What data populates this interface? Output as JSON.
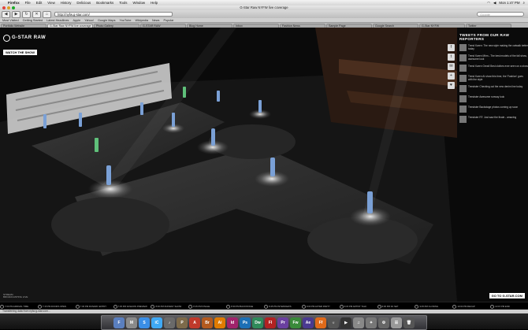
{
  "menubar": {
    "app": "Firefox",
    "items": [
      "File",
      "Edit",
      "View",
      "History",
      "Delicious",
      "Bookmarks",
      "Tools",
      "Window",
      "Help"
    ],
    "clock": "Mon 1:47 PM"
  },
  "window": {
    "title": "G-Star Raw NYFW live coverage"
  },
  "toolbar": {
    "url": "http://nyfw.g-star.com/",
    "search_placeholder": "Google"
  },
  "bookmarks": [
    "Most Visited",
    "Getting Started",
    "Latest Headlines",
    "Apple",
    "Yahoo!",
    "Google Maps",
    "YouTube",
    "Wikipedia",
    "News",
    "Popular"
  ],
  "tabs": [
    {
      "label": "Portfolio Website"
    },
    {
      "label": "Photo Gallery"
    },
    {
      "label": "G-STAR RAW"
    },
    {
      "label": "Blog Home"
    },
    {
      "label": "Inbox"
    },
    {
      "label": "Fashion News"
    },
    {
      "label": "Sample Page"
    },
    {
      "label": "Google Search"
    },
    {
      "label": "G-Star NYFW"
    },
    {
      "label": "Twitter"
    },
    {
      "label": "Flickr"
    }
  ],
  "active_tab": "G-Star Raw NYFW live coverage",
  "stage": {
    "logo": "G-STAR RAW",
    "watch_button": "WATCH THE SHOW",
    "credit_line1": "STREAM",
    "credit_line2": "BROADCASTING LIVE",
    "go_button": "GO TO G-STAR.COM"
  },
  "twitter": {
    "heading": "TWEETS FROM OUR RAW REPORTERS",
    "tweets": [
      "Trend Karen: The new style making the catwalk better today",
      "Trend Karen Mhm...The best models of the fall show, awesome look",
      "Trend Karen Great! Best clothes ever seen on a show",
      "Trend Karen At show this time, the 'Fashion' goes with the style",
      "Trendster Checking out the new denim line today",
      "Trendster Awesome runway look",
      "Trendster Backstage photos coming up soon",
      "Trendster RT: Just saw the finale - amazing"
    ],
    "share_icons": [
      "f",
      "t",
      "✉",
      "+",
      "♥"
    ]
  },
  "schedule": [
    "7:00 PM ARRIVAL TIME",
    "7:15 PM DOORS OPEN",
    "7:30 PM RUNWAY ENTRY",
    "7:45 PM FASHION PREVIEW",
    "8:00 PM RUNWAY SHOW",
    "8:15 PM FINALE",
    "8:30 PM BACKSTAGE",
    "8:45 PM INTERVIEWS",
    "9:00 PM AFTER PARTY",
    "9:15 PM ARTIST TALK",
    "9:30 PM DJ SET",
    "9:45 PM CLOSING",
    "10:00 PM RECAP",
    "10:15 PM END"
  ],
  "status": {
    "text": "Transferring data from nyfw.g-star.com..."
  },
  "dock": [
    {
      "label": "F",
      "color": "#5a7fbf"
    },
    {
      "label": "M",
      "color": "#8a8a8a"
    },
    {
      "label": "S",
      "color": "#3a8ee6"
    },
    {
      "label": "iC",
      "color": "#3fa9f5"
    },
    {
      "label": "♪",
      "color": "#6a6a6a"
    },
    {
      "label": "P",
      "color": "#7d6a4a"
    },
    {
      "label": "A",
      "color": "#c0392b"
    },
    {
      "label": "Br",
      "color": "#b35a1f"
    },
    {
      "label": "Ai",
      "color": "#e07b00"
    },
    {
      "label": "Id",
      "color": "#a0236b"
    },
    {
      "label": "Ps",
      "color": "#1c6fb5"
    },
    {
      "label": "Dw",
      "color": "#2f8a5a"
    },
    {
      "label": "Fl",
      "color": "#b22222"
    },
    {
      "label": "Pr",
      "color": "#6a3fa0"
    },
    {
      "label": "Fw",
      "color": "#3a8a3a"
    },
    {
      "label": "Ae",
      "color": "#4a3a90"
    },
    {
      "label": "Ff",
      "color": "#e06a1a"
    },
    {
      "label": "☼",
      "color": "#555"
    },
    {
      "label": "▶",
      "color": "#333"
    },
    {
      "label": "♫",
      "color": "#888"
    },
    {
      "label": "✦",
      "color": "#777"
    },
    {
      "label": "⚙",
      "color": "#666"
    },
    {
      "label": "☰",
      "color": "#999"
    },
    {
      "label": "🗑",
      "color": "#555"
    }
  ]
}
